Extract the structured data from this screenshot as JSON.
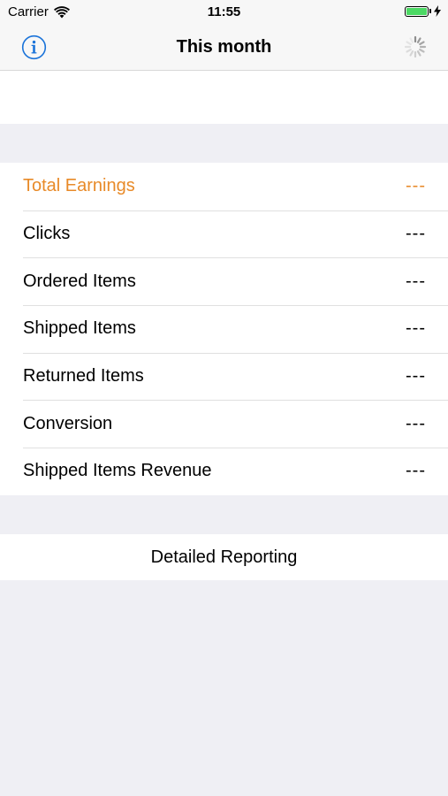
{
  "status_bar": {
    "carrier": "Carrier",
    "time": "11:55",
    "battery_level": 1.0,
    "battery_color": "#4cd964",
    "wifi_icon": "wifi-icon",
    "charging_icon": "bolt-icon"
  },
  "nav": {
    "title": "This month",
    "left_icon": "info-icon",
    "right_icon": "activity-spinner-icon",
    "tint_color": "#1a73d9"
  },
  "stats": [
    {
      "label": "Total Earnings",
      "value": "---",
      "accent": true
    },
    {
      "label": "Clicks",
      "value": "---",
      "accent": false
    },
    {
      "label": "Ordered Items",
      "value": "---",
      "accent": false
    },
    {
      "label": "Shipped Items",
      "value": "---",
      "accent": false
    },
    {
      "label": "Returned Items",
      "value": "---",
      "accent": false
    },
    {
      "label": "Conversion",
      "value": "---",
      "accent": false
    },
    {
      "label": "Shipped Items Revenue",
      "value": "---",
      "accent": false
    }
  ],
  "accent_color": "#e88a28",
  "detailed_reporting": {
    "label": "Detailed Reporting"
  }
}
